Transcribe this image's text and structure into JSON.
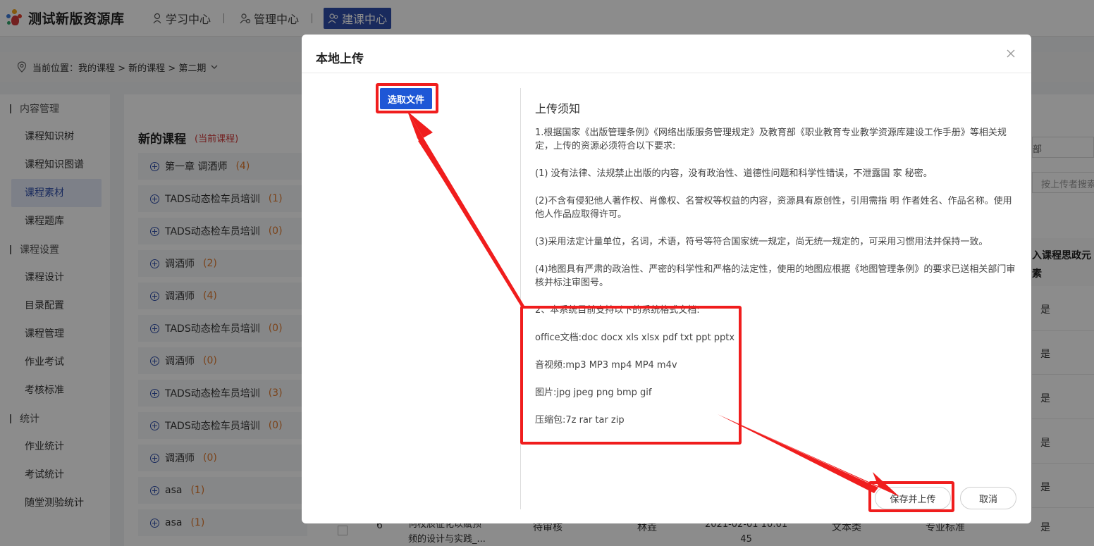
{
  "app": {
    "title": "测试新版资源库"
  },
  "nav": [
    {
      "label": "学习中心",
      "icon": "graduation-icon",
      "active": false
    },
    {
      "label": "管理中心",
      "icon": "user-gear-icon",
      "active": false
    },
    {
      "label": "建课中心",
      "icon": "users-icon",
      "active": true
    }
  ],
  "breadcrumb": {
    "label": "当前位置：我的课程 > 新的课程 > 第二期"
  },
  "sidebar": {
    "groups": [
      {
        "title": "内容管理",
        "items": [
          "课程知识树",
          "课程知识图谱",
          "课程素材",
          "课程题库"
        ]
      },
      {
        "title": "课程设置",
        "items": [
          "课程设计",
          "目录配置",
          "课程管理",
          "作业考试",
          "考核标准"
        ]
      },
      {
        "title": "统计",
        "items": [
          "作业统计",
          "考试统计",
          "随堂测验统计"
        ]
      }
    ],
    "active_item": "课程素材"
  },
  "course": {
    "title": "新的课程",
    "tag": "(当前课程)",
    "chapters": [
      {
        "name": "第一章 调酒师",
        "count": "(4)"
      },
      {
        "name": "TADS动态检车员培训",
        "count": "(1)"
      },
      {
        "name": "TADS动态检车员培训",
        "count": "(0)"
      },
      {
        "name": "调酒师",
        "count": "(2)"
      },
      {
        "name": "调酒师",
        "count": "(4)"
      },
      {
        "name": "TADS动态检车员培训",
        "count": "(0)"
      },
      {
        "name": "调酒师",
        "count": "(0)"
      },
      {
        "name": "TADS动态检车员培训",
        "count": "(3)"
      },
      {
        "name": "TADS动态检车员培训",
        "count": "(0)"
      },
      {
        "name": "调酒师",
        "count": "(0)"
      },
      {
        "name": "asa",
        "count": "(1)"
      },
      {
        "name": "asa",
        "count": "(1)"
      }
    ]
  },
  "table_bg": {
    "search_placeholder": "按上传者搜索",
    "partial_text": "部",
    "column_header": "入课程思政元素",
    "yes_values": [
      "是",
      "是",
      "是",
      "是",
      "是",
      "是"
    ],
    "row6": {
      "index": "6",
      "title": "何校辰征化以赋预\n频的设计与实践_...",
      "status": "待审核",
      "uploader": "林垚",
      "time": "2021-02-01 10:01\n45",
      "type": "文本类",
      "category": "专业标准",
      "flag": "是"
    }
  },
  "dialog": {
    "title": "本地上传",
    "pick_button": "选取文件",
    "notice_title": "上传须知",
    "paragraphs": [
      "1.根据国家《出版管理条例》《网络出版服务管理规定》及教育部《职业教育专业教学资源库建设工作手册》等相关规定，上传的资源必须符合以下要求:",
      "(1) 没有法律、法规禁止出版的内容，没有政治性、道德性问题和科学性错误，不泄露国 家 秘密。",
      "(2)不含有侵犯他人著作权、肖像权、名誉权等权益的内容，资源具有原创性，引用需指 明 作者姓名、作品名称。使用他人作品应取得许可。",
      "(3)采用法定计量单位，名词，术语，符号等符合国家统一规定，尚无统一规定的，可采用习惯用法并保持一致。",
      "(4)地图具有严肃的政治性、严密的科学性和严格的法定性，使用的地图应根据《地图管理条例》的要求已送相关部门审核并标注审图号。"
    ],
    "formats": [
      "2、本系统目前支持以下的系统格式文档:",
      "office文档:doc docx xls xlsx pdf txt ppt pptx",
      "音视频:mp3 MP3 mp4 MP4 m4v",
      "图片:jpg jpeg png bmp gif",
      "压缩包:7z rar tar zip"
    ],
    "save_button": "保存并上传",
    "cancel_button": "取消"
  },
  "colors": {
    "accent": "#2e4eaa",
    "primary_button": "#1e57d6",
    "annotation": "#f01d1d",
    "count": "#e07a2f"
  }
}
